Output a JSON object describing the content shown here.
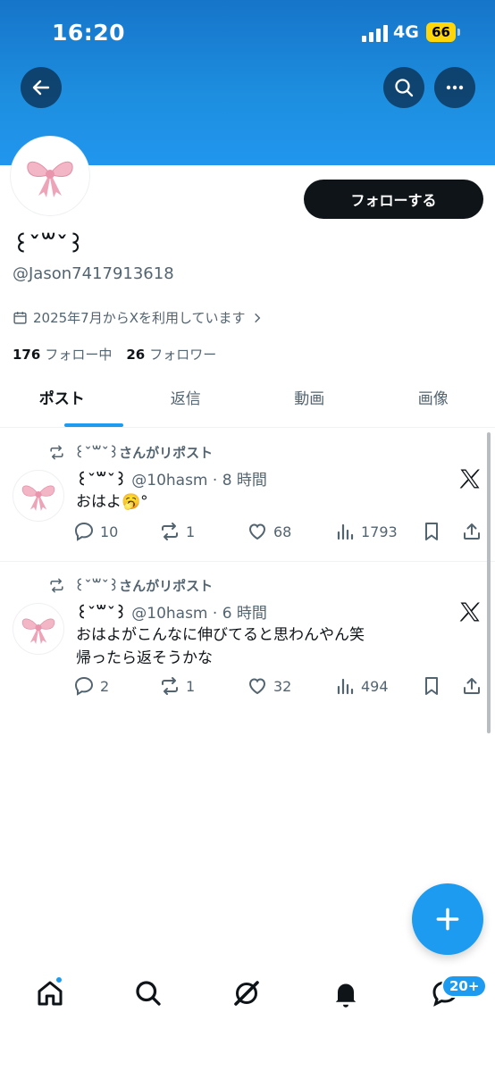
{
  "status_bar": {
    "time": "16:20",
    "network": "4G",
    "battery": "66"
  },
  "profile": {
    "display_name": "꒰ˇ꒳ˇ꒱",
    "handle": "@Jason7417913618",
    "joined": "2025年7月からXを利用しています",
    "following_count": "176",
    "following_label": "フォロー中",
    "followers_count": "26",
    "followers_label": "フォロワー",
    "follow_button": "フォローする"
  },
  "tabs": [
    "ポスト",
    "返信",
    "動画",
    "画像"
  ],
  "posts": [
    {
      "repost_label": "꒰ˇ꒳ˇ꒱さんがリポスト",
      "author": "꒰ˇ꒳ˇ꒱",
      "meta": "@10hasm · 8 時間",
      "text": "おはよ🥱°",
      "replies": "10",
      "reposts": "1",
      "likes": "68",
      "views": "1793"
    },
    {
      "repost_label": "꒰ˇ꒳ˇ꒱さんがリポスト",
      "author": "꒰ˇ꒳ˇ꒱",
      "meta": "@10hasm · 6 時間",
      "text": "おはよがこんなに伸びてると思わんやん笑\n帰ったら返そうかな",
      "replies": "2",
      "reposts": "1",
      "likes": "32",
      "views": "494"
    }
  ],
  "nav": {
    "messages_badge": "20+"
  },
  "colors": {
    "accent": "#1d9bf0",
    "banner": "#1e8fe0",
    "text": "#0f1419",
    "muted": "#536471"
  }
}
